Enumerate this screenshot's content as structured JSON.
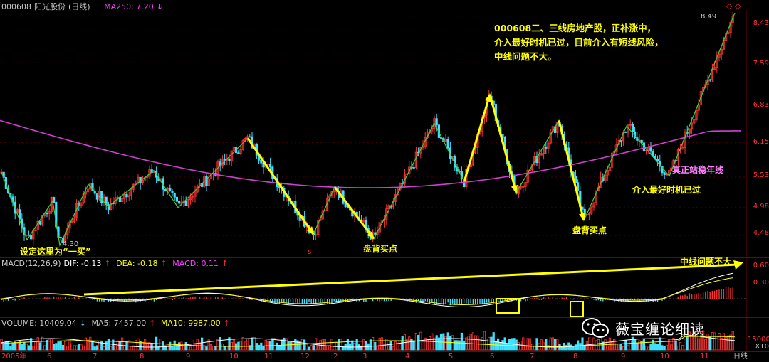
{
  "header": {
    "code": "000608",
    "name": "阳光股份",
    "period": "(日线)",
    "ma250_label": "MA250: 7.20"
  },
  "macd_header": {
    "name": "MACD(12,26,9)",
    "dif": "DIF: -0.13",
    "dea": "DEA: -0.18",
    "macd": "MACD: 0.11"
  },
  "volume_header": {
    "volume": "VOLUME: 10409.04",
    "ma5": "MA5: 7457.00",
    "ma10": "MA10: 9987.00"
  },
  "price_axis": {
    "ticks": [
      "8.43",
      "7.59",
      "6.83",
      "6.15",
      "5.53",
      "4.98",
      "4.48"
    ],
    "max_label": "8.49",
    "min_label": "4.30"
  },
  "macd_axis": {
    "ticks": [
      "0.60",
      "0.30"
    ]
  },
  "volume_axis": {
    "ticks": [
      "15000"
    ],
    "unit": "X10"
  },
  "x_axis": {
    "labels": [
      "2005年",
      "6",
      "7",
      "8",
      "9",
      "10",
      "11",
      "12",
      "2",
      "3",
      "4",
      "5",
      "6",
      "7",
      "8",
      "9",
      "10",
      "11",
      "日线"
    ]
  },
  "annotations": {
    "note_lines": [
      "000608二、三线房地产股，正补涨中，",
      "介入最好时机已过，目前介入有短线风险，",
      "中线问题不大。"
    ],
    "first_buy": "设定这里为“一买”",
    "pan_bei_1": "盘背买点",
    "pan_bei_2": "盘背买点",
    "stand_year_line": "真正站稳年线",
    "best_time_passed": "介入最好时机已过",
    "mid_ok": "中线问题不大",
    "marker_s": "s"
  },
  "watermark": {
    "text": "薇宝缠论细读",
    "icon": "wechat-icon"
  },
  "colors": {
    "up": "#ff3333",
    "down": "#40e0ff",
    "ma250": "#d040d0",
    "bi": "#40d040",
    "arrow": "#ffff00",
    "dif": "#ffffff",
    "dea": "#ffff00",
    "box": "#ffff00",
    "bg": "#000000",
    "grid": "#7a0000"
  },
  "chart_data": {
    "type": "candlestick",
    "series_ma250": "MA250",
    "price_ylim": [
      4.3,
      8.49
    ],
    "zigzag_pivots": [
      {
        "x": "2005-05",
        "y": 5.62
      },
      {
        "x": "2005-06",
        "y": 4.4
      },
      {
        "x": "2005-06b",
        "y": 5.1
      },
      {
        "x": "2005-07",
        "y": 4.3
      },
      {
        "x": "2005-07b",
        "y": 5.4
      },
      {
        "x": "2005-07c",
        "y": 5.0
      },
      {
        "x": "2005-08",
        "y": 5.65
      },
      {
        "x": "2005-09",
        "y": 4.98
      },
      {
        "x": "2005-10",
        "y": 6.23
      },
      {
        "x": "2005-12",
        "y": 4.5
      },
      {
        "x": "2006-02",
        "y": 5.35
      },
      {
        "x": "2006-03",
        "y": 4.42
      },
      {
        "x": "2006-04",
        "y": 6.5
      },
      {
        "x": "2006-05",
        "y": 5.45
      },
      {
        "x": "2006-06",
        "y": 7.02
      },
      {
        "x": "2006-07",
        "y": 5.25
      },
      {
        "x": "2006-08",
        "y": 6.55
      },
      {
        "x": "2006-08b",
        "y": 4.75
      },
      {
        "x": "2006-09",
        "y": 6.45
      },
      {
        "x": "2006-10",
        "y": 5.55
      },
      {
        "x": "2006-11",
        "y": 8.49
      }
    ],
    "macd_ylim": [
      -0.3,
      0.6
    ],
    "volume_ytick": 15000
  }
}
